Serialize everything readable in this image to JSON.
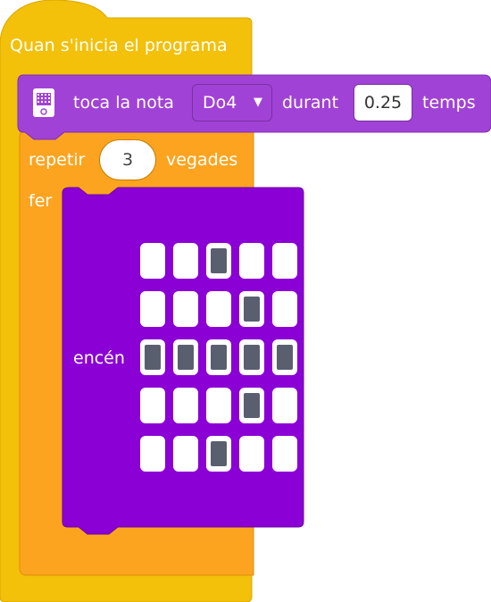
{
  "event_block": {
    "label": "Quan s'inicia el programa"
  },
  "play_note_block": {
    "icon": "microbit-icon",
    "label_play": "toca la nota",
    "note_value": "Do4",
    "label_during": "durant",
    "beats_value": "0.25",
    "label_beats": "temps"
  },
  "repeat_block": {
    "label_repeat": "repetir",
    "times_value": "3",
    "label_times": "vegades",
    "label_do": "fer"
  },
  "led_block": {
    "label": "encén",
    "grid": [
      [
        0,
        0,
        1,
        0,
        0
      ],
      [
        0,
        0,
        0,
        1,
        0
      ],
      [
        1,
        1,
        1,
        1,
        1
      ],
      [
        0,
        0,
        0,
        1,
        0
      ],
      [
        0,
        0,
        1,
        0,
        0
      ]
    ]
  },
  "colors": {
    "event": "#f3c00a",
    "microbit": "#a142d6",
    "loop": "#fca41f",
    "led": "#8b00d4",
    "led_off": "#ffffff",
    "led_on": "#5a5f70"
  }
}
